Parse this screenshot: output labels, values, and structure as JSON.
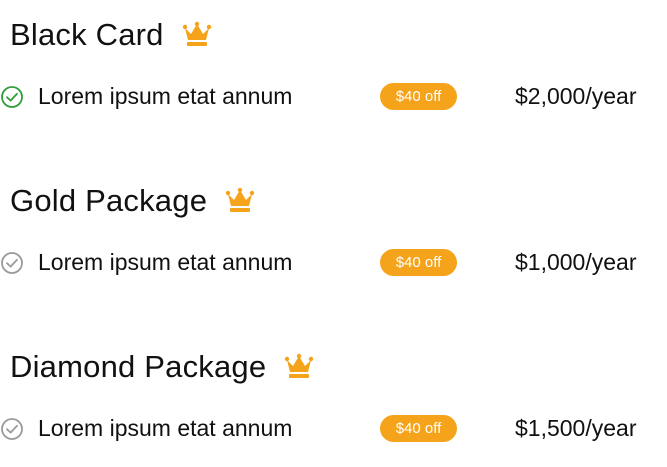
{
  "colors": {
    "accent": "#F5A31A",
    "check_active": "#2E9E3A",
    "check_inactive": "#9A9A9A",
    "text": "#111111"
  },
  "plans": [
    {
      "title": "Black Card",
      "icon": "crown-icon",
      "feature": "Lorem ipsum etat annum",
      "check_state": "active",
      "badge": "$40 off",
      "price": "$2,000/year"
    },
    {
      "title": "Gold Package",
      "icon": "crown-icon",
      "feature": "Lorem ipsum etat annum",
      "check_state": "inactive",
      "badge": "$40 off",
      "price": "$1,000/year"
    },
    {
      "title": "Diamond Package",
      "icon": "crown-icon",
      "feature": "Lorem ipsum etat annum",
      "check_state": "inactive",
      "badge": "$40 off",
      "price": "$1,500/year"
    }
  ]
}
